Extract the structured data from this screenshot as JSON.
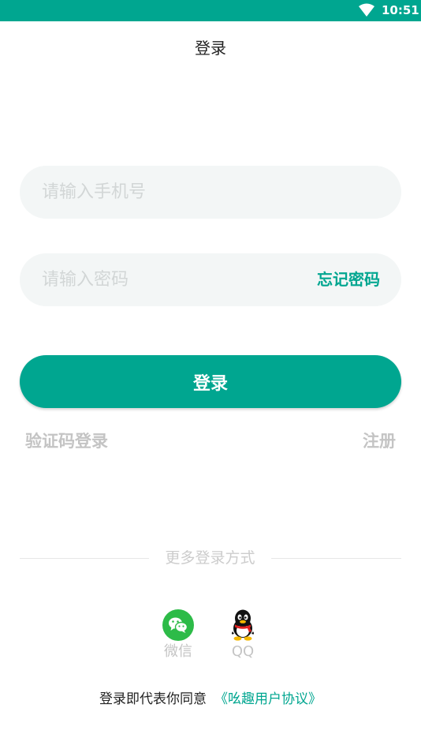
{
  "status_bar": {
    "time": "10:51",
    "wifi_icon": "wifi-icon",
    "background": "#00a690"
  },
  "header": {
    "title": "登录"
  },
  "form": {
    "phone": {
      "value": "",
      "placeholder": "请输入手机号"
    },
    "password": {
      "value": "",
      "placeholder": "请输入密码"
    },
    "forgot_label": "忘记密码",
    "login_label": "登录",
    "sms_login_label": "验证码登录",
    "register_label": "注册"
  },
  "more_login": {
    "label": "更多登录方式",
    "options": [
      {
        "label": "微信",
        "icon": "wechat-icon"
      },
      {
        "label": "QQ",
        "icon": "qq-icon"
      }
    ]
  },
  "agreement": {
    "text": "登录即代表你同意",
    "link_label": "《吆趣用户协议》"
  },
  "colors": {
    "accent": "#00a690",
    "field_background": "#f3f6f6",
    "muted_text": "#c4c4c4",
    "wechat_green": "#2dbb48"
  }
}
